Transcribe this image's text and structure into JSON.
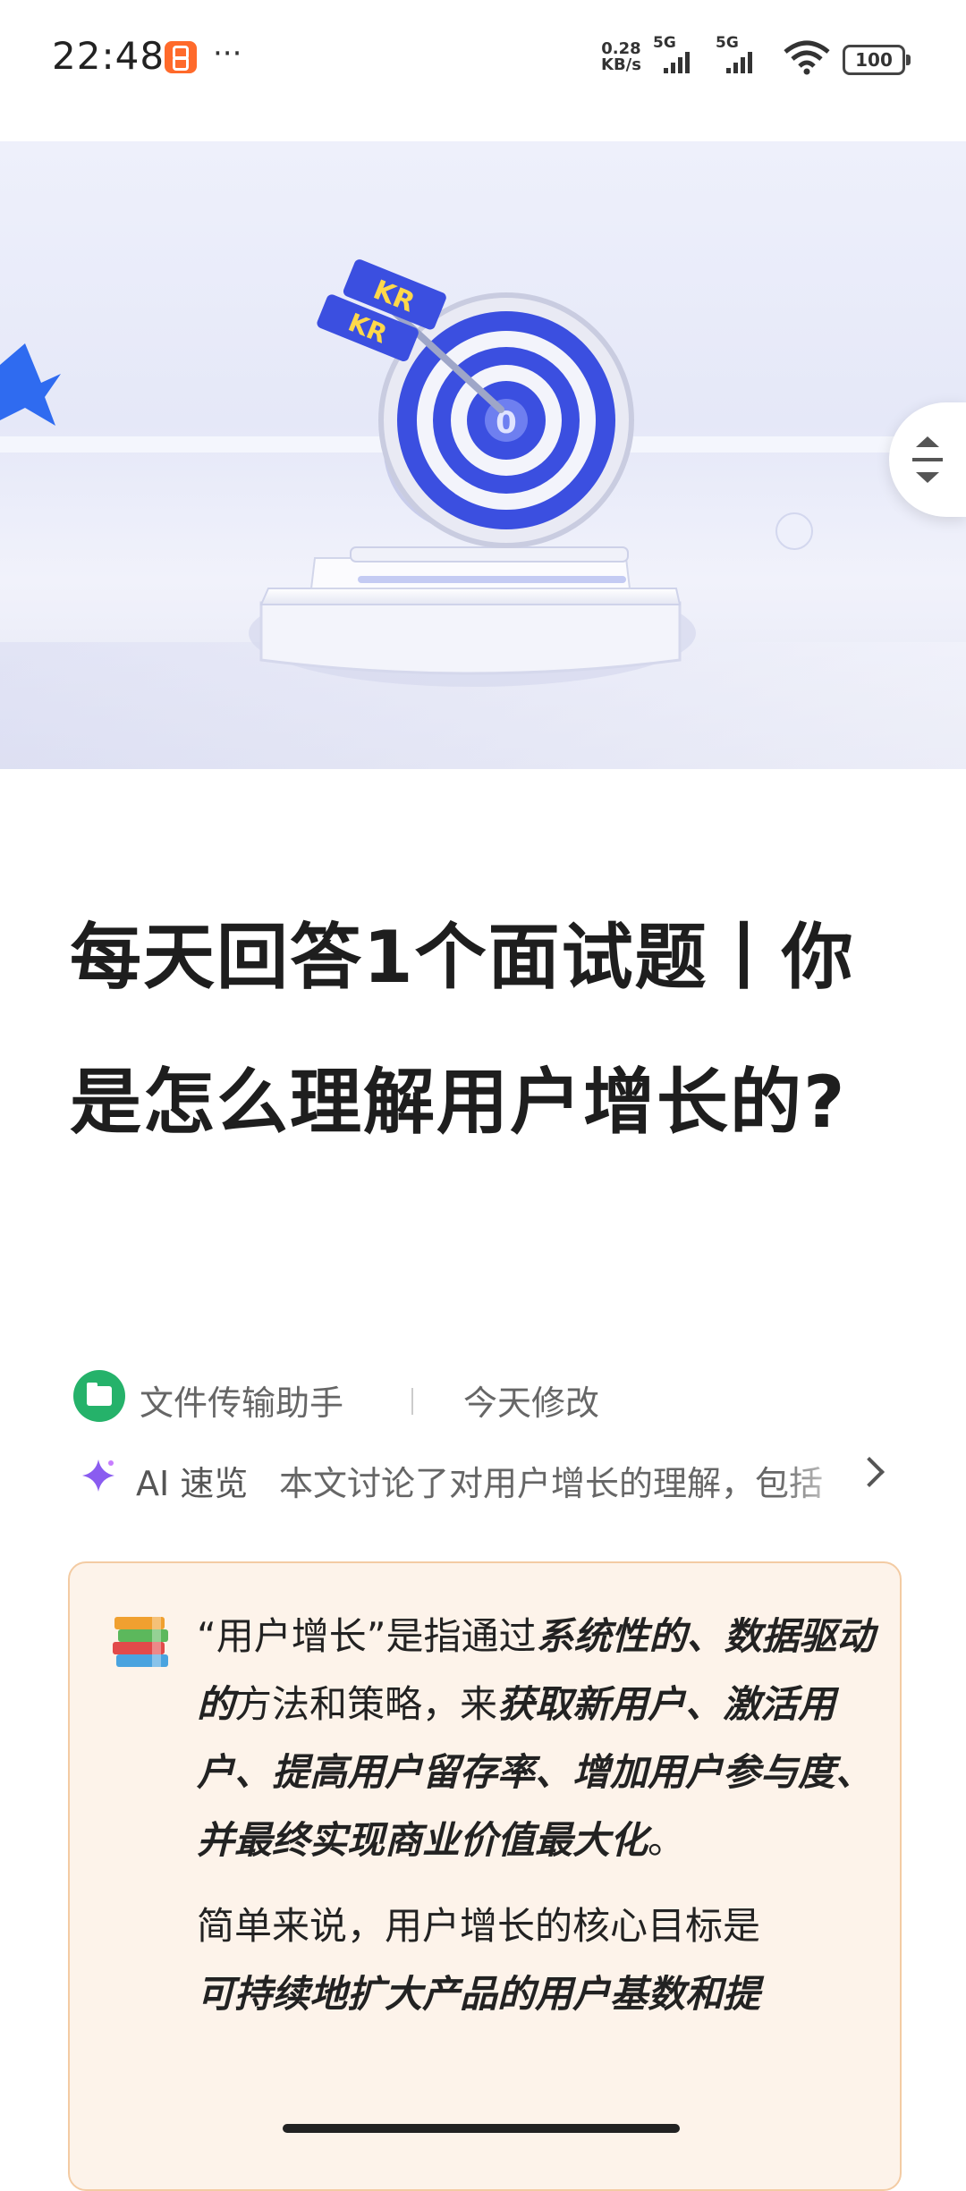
{
  "status_bar": {
    "time": "22:48",
    "dots": "···",
    "net_speed_value": "0.28",
    "net_speed_unit": "KB/s",
    "signal1_label": "5G",
    "signal2_label": "5G",
    "battery": "100",
    "app_badge_icon": "orange-app-icon",
    "wifi_icon": "wifi-icon"
  },
  "hero": {
    "dart_label_top": "KR",
    "dart_label_bottom": "KR",
    "target_center": "0",
    "icons": [
      "target-icon",
      "star-icon",
      "collapse-icon"
    ]
  },
  "article": {
    "title": "每天回答1个面试题丨你是怎么理解用户增长的?",
    "author": "文件传输助手",
    "modified": "今天修改",
    "ai_label": "AI 速览",
    "ai_summary": "本文讨论了对用户增长的理解，包括",
    "callout": {
      "p1_a": "“用户增长”是指通过",
      "p1_b": "系统性的、数据驱动的",
      "p1_c": "方法和策略，来",
      "p1_d": "获取新用户、激活用户、提高用户留存率、增加用户参与度、并最终实现商业价值最大化",
      "p1_e": "。",
      "p2_a": "简单来说，用户增长的核心目标是",
      "p2_b": "可持续地扩大产品的用户基数和提"
    }
  },
  "colors": {
    "accent_blue": "#3b4fe0",
    "callout_bg": "#fdf3ea",
    "callout_border": "#f3cba3",
    "author_green": "#25b26a"
  }
}
